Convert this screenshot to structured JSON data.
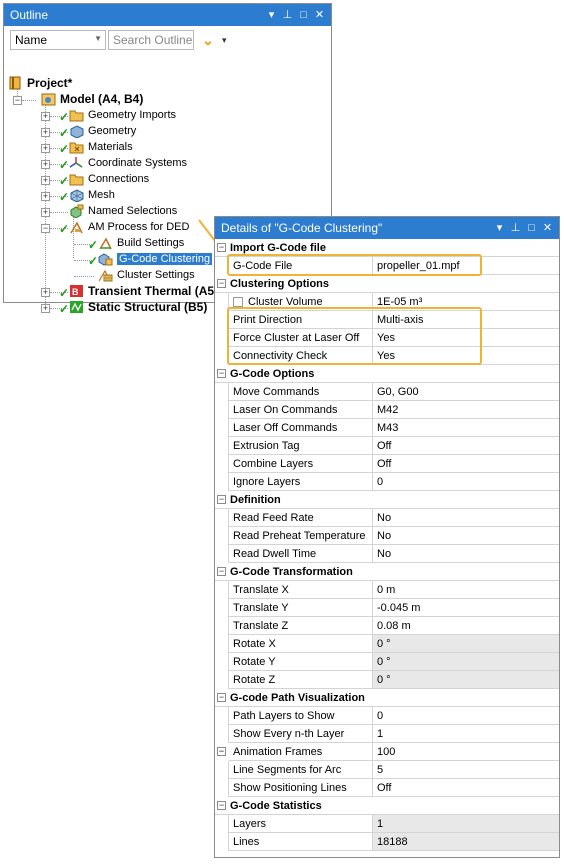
{
  "outline": {
    "title": "Outline",
    "title_buttons": [
      "▾",
      "⊥",
      "□",
      "✕"
    ],
    "filter_select": "Name",
    "search_placeholder": "Search Outline",
    "tree": [
      {
        "label": "Project*",
        "icon": "project-icon",
        "bold": true
      },
      {
        "label": "Model (A4, B4)",
        "icon": "model-icon",
        "bold": true
      },
      {
        "label": "Geometry Imports",
        "icon": "folder-icon"
      },
      {
        "label": "Geometry",
        "icon": "geometry-icon"
      },
      {
        "label": "Materials",
        "icon": "folder-icon"
      },
      {
        "label": "Coordinate Systems",
        "icon": "coordinate-systems-icon"
      },
      {
        "label": "Connections",
        "icon": "folder-icon"
      },
      {
        "label": "Mesh",
        "icon": "mesh-icon"
      },
      {
        "label": "Named Selections",
        "icon": "named-selections-icon"
      },
      {
        "label": "AM Process for DED",
        "icon": "am-process-icon"
      },
      {
        "label": "Build Settings",
        "icon": "build-settings-icon"
      },
      {
        "label": "G-Code Clustering",
        "icon": "gcode-clustering-icon"
      },
      {
        "label": "Cluster Settings",
        "icon": "cluster-settings-icon"
      },
      {
        "label": "Transient Thermal (A5)",
        "icon": "transient-thermal-icon",
        "bold": true
      },
      {
        "label": "Static Structural (B5)",
        "icon": "static-structural-icon",
        "bold": true
      }
    ]
  },
  "details": {
    "title": "Details of \"G-Code Clustering\"",
    "title_buttons": [
      "▾",
      "⊥",
      "□",
      "✕"
    ],
    "sections": [
      {
        "name": "Import G-Code file",
        "rows": [
          {
            "label": "G-Code File",
            "value": "propeller_01.mpf"
          }
        ]
      },
      {
        "name": "Clustering Options",
        "rows": [
          {
            "label": "Cluster Volume",
            "value": "1E-05 m³",
            "checkbox": true
          },
          {
            "label": "Print Direction",
            "value": "Multi-axis"
          },
          {
            "label": "Force Cluster at Laser Off",
            "value": "Yes"
          },
          {
            "label": "Connectivity Check",
            "value": "Yes"
          }
        ]
      },
      {
        "name": "G-Code Options",
        "rows": [
          {
            "label": "Move Commands",
            "value": "G0, G00"
          },
          {
            "label": "Laser On Commands",
            "value": "M42"
          },
          {
            "label": "Laser Off Commands",
            "value": "M43"
          },
          {
            "label": "Extrusion Tag",
            "value": "Off"
          },
          {
            "label": "Combine Layers",
            "value": "Off"
          },
          {
            "label": "Ignore Layers",
            "value": "0"
          }
        ]
      },
      {
        "name": "Definition",
        "rows": [
          {
            "label": "Read Feed Rate",
            "value": "No"
          },
          {
            "label": "Read Preheat Temperature",
            "value": "No"
          },
          {
            "label": "Read Dwell Time",
            "value": "No"
          }
        ]
      },
      {
        "name": "G-Code Transformation",
        "rows": [
          {
            "label": "Translate X",
            "value": "0 m"
          },
          {
            "label": "Translate Y",
            "value": "-0.045 m"
          },
          {
            "label": "Translate Z",
            "value": "0.08 m"
          },
          {
            "label": "Rotate X",
            "value": "0 °",
            "readonly": true
          },
          {
            "label": "Rotate Y",
            "value": "0 °",
            "readonly": true
          },
          {
            "label": "Rotate Z",
            "value": "0 °",
            "readonly": true
          }
        ]
      },
      {
        "name": "G-code Path Visualization",
        "rows": [
          {
            "label": "Path Layers to Show",
            "value": "0"
          },
          {
            "label": "Show Every n-th Layer",
            "value": "1"
          },
          {
            "label": "Animation Frames",
            "value": "100"
          },
          {
            "label": "Line Segments for Arc",
            "value": "5"
          },
          {
            "label": "Show Positioning Lines",
            "value": "Off"
          }
        ]
      },
      {
        "name": "G-Code Statistics",
        "rows": [
          {
            "label": "Layers",
            "value": "1",
            "readonly": true
          },
          {
            "label": "Lines",
            "value": "18188",
            "readonly": true
          }
        ]
      }
    ]
  },
  "colors": {
    "accent": "#2c7dd0",
    "highlight": "#f2b233",
    "check": "#1a9e1a"
  }
}
